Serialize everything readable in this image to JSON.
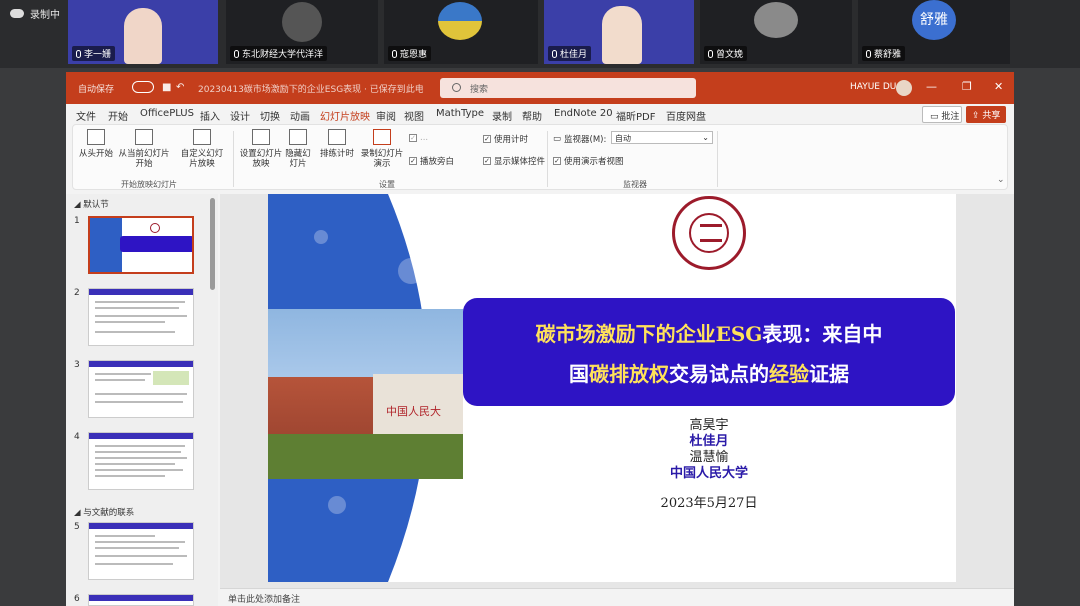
{
  "meeting": {
    "recording_label": "录制中",
    "participants": [
      {
        "name": "李一姗"
      },
      {
        "name": "东北财经大学代洋洋"
      },
      {
        "name": "寇恩惠"
      },
      {
        "name": "杜佳月"
      },
      {
        "name": "曾文娩"
      },
      {
        "name": "蔡舒雅",
        "avatar_text": "舒雅"
      }
    ]
  },
  "ppt": {
    "autosave": "自动保存",
    "doc_title": "20230413碳市场激励下的企业ESG表现 · 已保存到此电脑",
    "search_placeholder": "搜索",
    "user": "HAYUE DU",
    "tabs": [
      "文件",
      "开始",
      "OfficePLUS",
      "插入",
      "设计",
      "切换",
      "动画",
      "幻灯片放映",
      "审阅",
      "视图",
      "MathType",
      "录制",
      "帮助",
      "EndNote 20",
      "福昕PDF",
      "百度网盘"
    ],
    "active_tab": "幻灯片放映",
    "comment_btn": "批注",
    "share_btn": "共享",
    "ribbon": {
      "from_beginning": "从头开始",
      "from_current": "从当前幻灯片开始",
      "custom_show": "自定义幻灯片放映",
      "group_start": "开始放映幻灯片",
      "setup_show": "设置幻灯片放映",
      "hide_slide": "隐藏幻灯片",
      "rehearse": "排练计时",
      "record": "录制幻灯片演示",
      "play_narration": "播放旁白",
      "use_timing": "使用计时",
      "show_media": "显示媒体控件",
      "record_label": "...",
      "group_setup": "设置",
      "monitor_label": "监视器(M):",
      "monitor_value": "自动",
      "presenter_view": "使用演示者视图",
      "group_monitor": "监视器"
    },
    "sections": {
      "default": "默认节",
      "related": "与文献的联系"
    },
    "slide_numbers": [
      "1",
      "2",
      "3",
      "4",
      "5",
      "6"
    ],
    "notes_placeholder": "单击此处添加备注"
  },
  "slide": {
    "title_line1_pre": "碳市场激励下的企业",
    "title_line1_mid": "ESG",
    "title_line1_post": "表现：来自中",
    "title_line2_a": "国",
    "title_line2_b": "碳排放权",
    "title_line2_c": "交易试点的",
    "title_line2_d": "经验",
    "title_line2_e": "证据",
    "authors": [
      "高昊宇",
      "杜佳月",
      "温慧愉"
    ],
    "affiliation": "中国人民大学",
    "date": "2023年5月27日",
    "sign_text": "中国人民大",
    "colors": {
      "title_box": "#2e14c4",
      "highlight": "#ffe25a",
      "accent": "#c43e1c"
    }
  }
}
